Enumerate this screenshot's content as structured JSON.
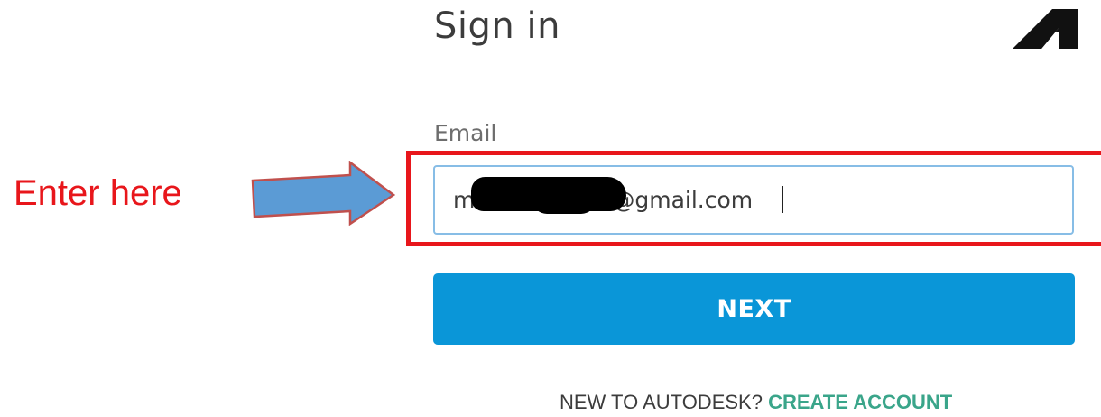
{
  "header": {
    "title": "Sign in",
    "logo_icon": "autodesk-logo-icon"
  },
  "form": {
    "email_label": "Email",
    "email_value": "m@gmail.com",
    "email_visible_suffix": "@gmail.com",
    "email_visible_prefix": "m",
    "next_label": "NEXT"
  },
  "footer": {
    "prompt": "NEW TO AUTODESK?",
    "create_account_label": "CREATE ACCOUNT"
  },
  "annotation": {
    "label": "Enter here",
    "arrow_icon": "right-arrow-icon",
    "color": "#e8161b",
    "arrow_color": "#5b9bd5"
  },
  "colors": {
    "primary_button": "#0a96d8",
    "link": "#3aa58a",
    "input_border": "#87bde6"
  }
}
